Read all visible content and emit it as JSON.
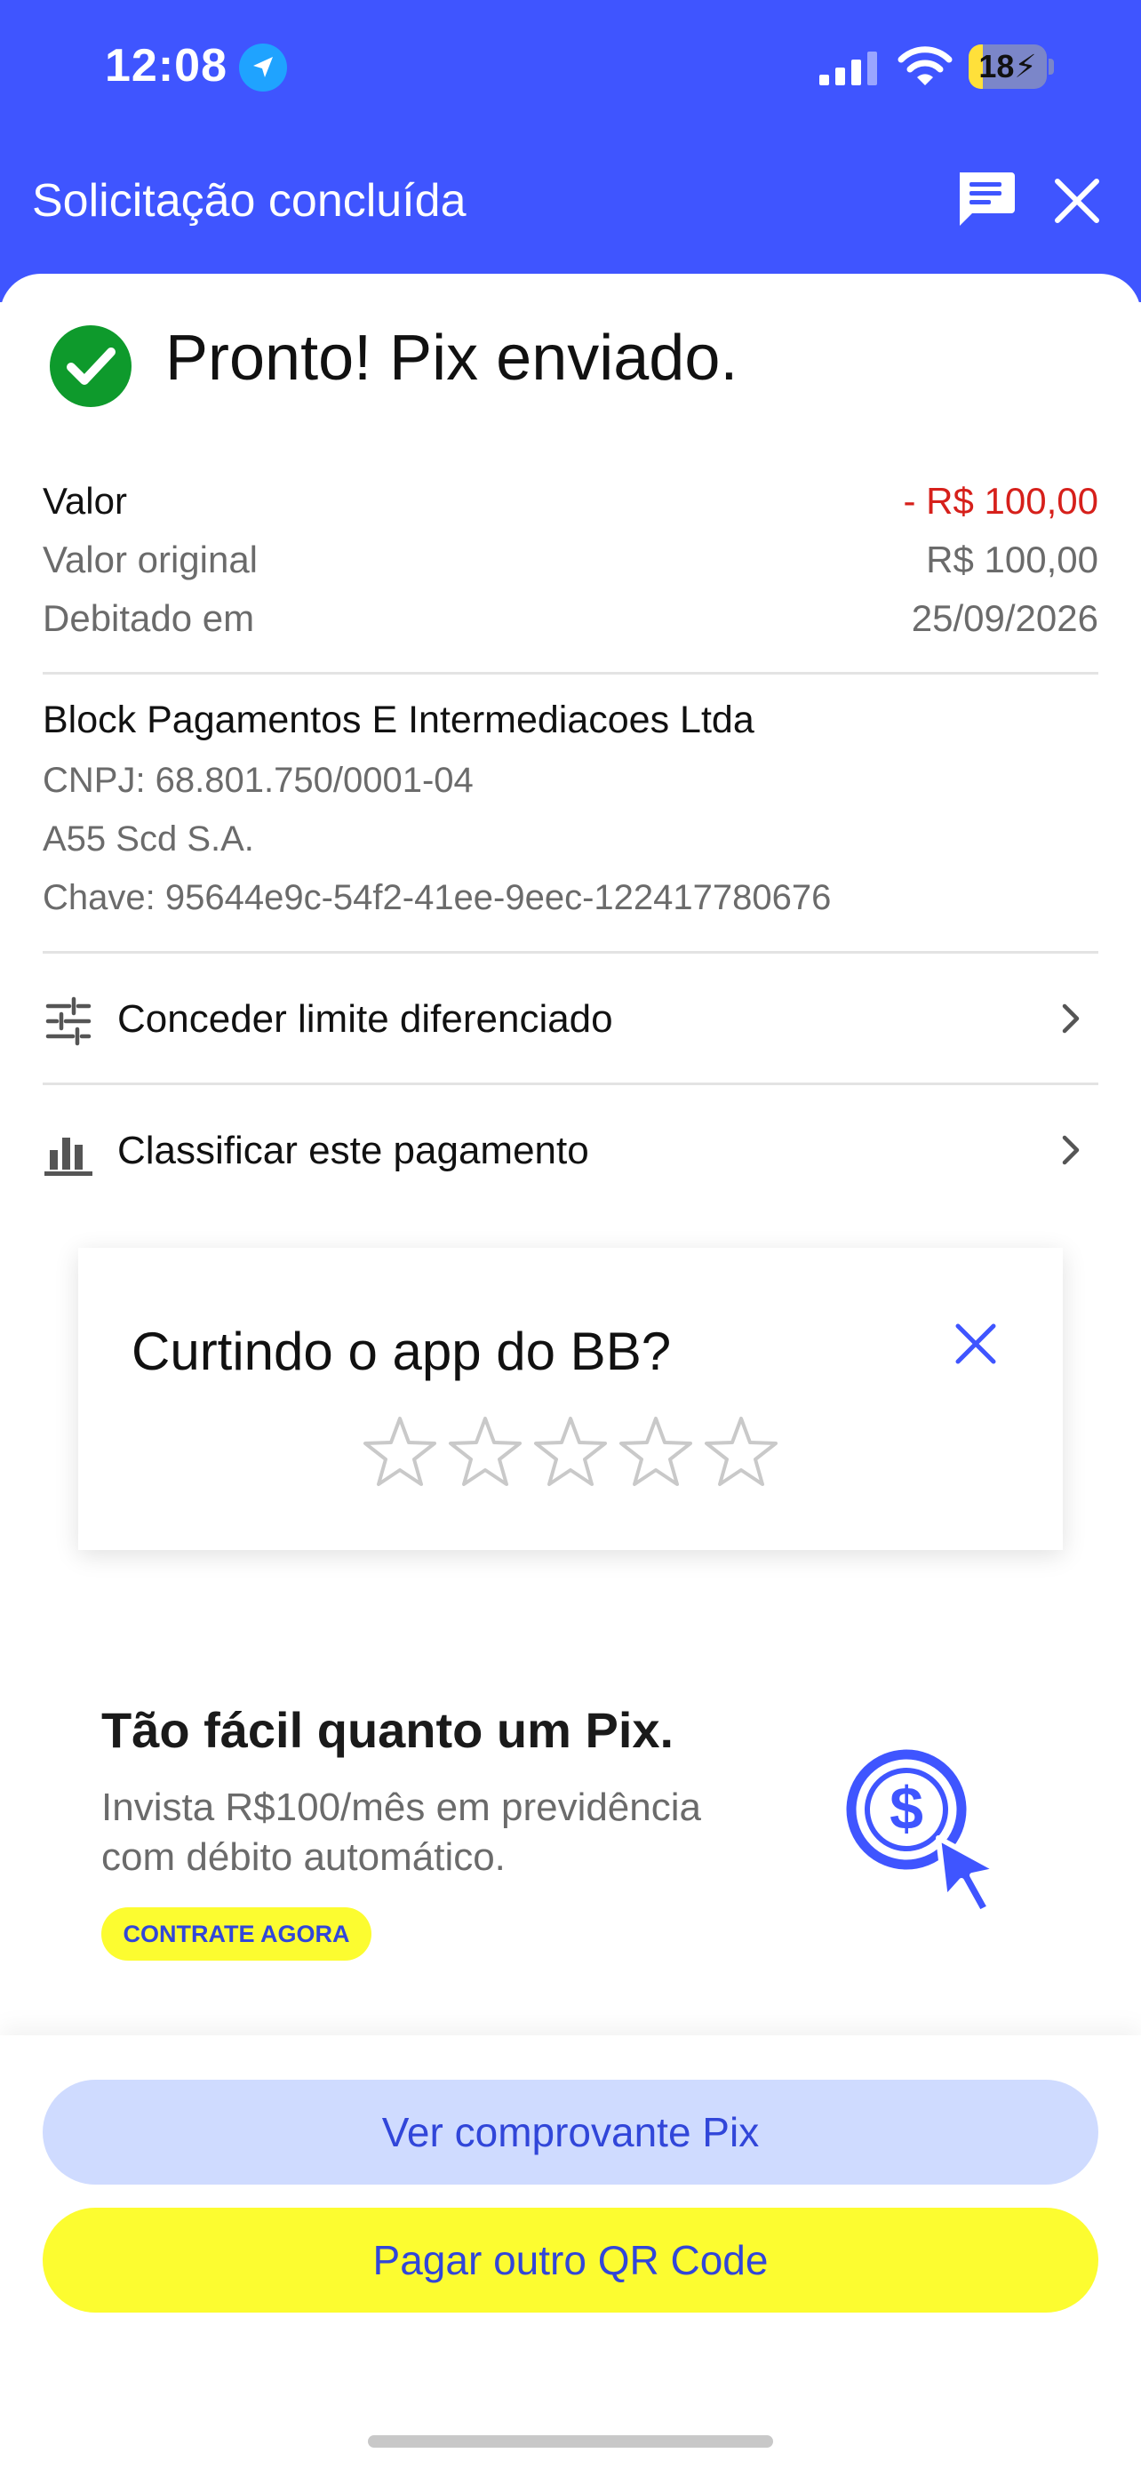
{
  "status_bar": {
    "time": "12:08",
    "battery": "18",
    "battery_level_percent": 18
  },
  "header": {
    "title": "Solicitação concluída"
  },
  "success": {
    "title": "Pronto! Pix enviado."
  },
  "summary": {
    "valor_label": "Valor",
    "valor_value": "- R$ 100,00",
    "original_label": "Valor original",
    "original_value": "R$ 100,00",
    "debitado_label": "Debitado em",
    "debitado_value": "25/09/2026"
  },
  "payee": {
    "name": "Block Pagamentos E Intermediacoes Ltda",
    "cnpj": "CNPJ: 68.801.750/0001-04",
    "institution": "A55 Scd S.A.",
    "key": "Chave: 95644e9c-54f2-41ee-9eec-122417780676"
  },
  "actions": {
    "limit_label": "Conceder limite diferenciado",
    "classify_label": "Classificar este pagamento"
  },
  "rating": {
    "title": "Curtindo o app do BB?",
    "stars_total": 5,
    "stars_selected": 0
  },
  "promo": {
    "title": "Tão fácil quanto um Pix.",
    "subtitle": "Invista R$100/mês em previdência com débito automático.",
    "cta": "CONTRATE AGORA"
  },
  "buttons": {
    "receipt": "Ver comprovante Pix",
    "pay_again": "Pagar outro QR Code"
  },
  "colors": {
    "brand_blue": "#3f55ff",
    "accent_yellow": "#fcfc30",
    "negative_red": "#d6201b",
    "success_green": "#0e9a2c"
  }
}
